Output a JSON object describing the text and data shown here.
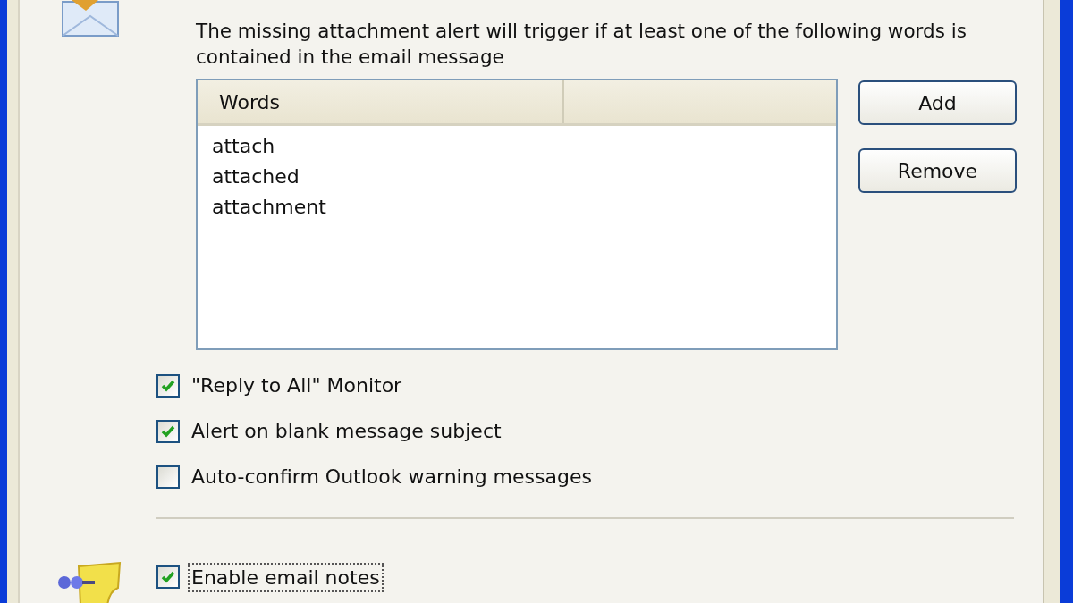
{
  "description": "The missing attachment alert will trigger if at least one of the following words is contained in the email message",
  "word_list": {
    "columns": [
      "Words"
    ],
    "rows": [
      "attach",
      "attached",
      "attachment"
    ]
  },
  "buttons": [
    "Add",
    "Remove"
  ],
  "options": [
    {
      "label": "\"Reply to All\" Monitor",
      "checked": true
    },
    {
      "label": "Alert on blank message subject",
      "checked": true
    },
    {
      "label": "Auto-confirm Outlook warning messages",
      "checked": false
    }
  ],
  "notes_option": {
    "label": "Enable email notes",
    "checked": true,
    "focused": true
  }
}
